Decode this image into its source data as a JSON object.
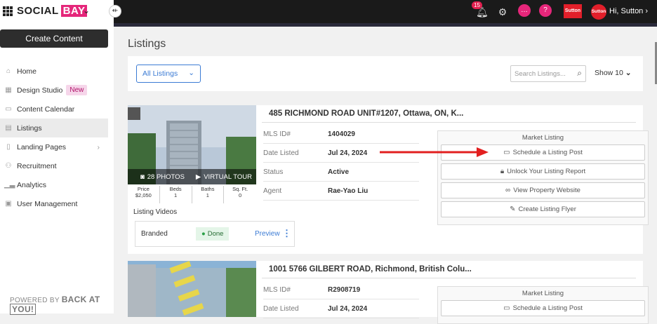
{
  "brand": {
    "name_part1": "SOCIAL",
    "name_part2": "BAY",
    "collapse_glyph": "⇷"
  },
  "sidebar": {
    "create_label": "Create Content",
    "items": [
      {
        "label": "Home",
        "icon": "home-icon"
      },
      {
        "label": "Design Studio",
        "icon": "design-icon",
        "badge": "New"
      },
      {
        "label": "Content Calendar",
        "icon": "calendar-icon"
      },
      {
        "label": "Listings",
        "icon": "listings-icon",
        "active": true
      },
      {
        "label": "Landing Pages",
        "icon": "page-icon",
        "chevron": true
      },
      {
        "label": "Recruitment",
        "icon": "people-icon"
      },
      {
        "label": "Analytics",
        "icon": "chart-icon"
      },
      {
        "label": "User Management",
        "icon": "users-icon"
      }
    ],
    "powered_by": "POWERED BY",
    "powered_brand": "BACK AT",
    "powered_you": "YOU!"
  },
  "topbar": {
    "notif_count": "15",
    "user_greeting": "Hi, Sutton",
    "sutton_logo": "Sutton",
    "sutton_avatar": "Sutton"
  },
  "page": {
    "title": "Listings"
  },
  "filters": {
    "select_value": "All Listings",
    "search_placeholder": "Search Listings...",
    "show_label": "Show 10"
  },
  "listings": [
    {
      "address": "485 RICHMOND ROAD UNIT#1207, Ottawa, ON, K...",
      "photos_label": "28 PHOTOS",
      "tour_label": "VIRTUAL TOUR",
      "stats": [
        {
          "k": "Price",
          "v": "$2,050"
        },
        {
          "k": "Beds",
          "v": "1"
        },
        {
          "k": "Baths",
          "v": "1"
        },
        {
          "k": "Sq. Ft.",
          "v": "0"
        }
      ],
      "rows": [
        {
          "k": "MLS ID#",
          "v": "1404029"
        },
        {
          "k": "Date Listed",
          "v": "Jul 24, 2024"
        },
        {
          "k": "Status",
          "v": "Active"
        },
        {
          "k": "Agent",
          "v": "Rae-Yao Liu"
        }
      ],
      "market_title": "Market Listing",
      "actions": [
        "Schedule a Listing Post",
        "Unlock Your Listing Report",
        "View Property Website",
        "Create Listing Flyer"
      ],
      "videos_title": "Listing Videos",
      "video": {
        "label": "Branded",
        "status": "Done",
        "preview": "Preview"
      }
    },
    {
      "address": "1001 5766 GILBERT ROAD, Richmond, British Colu...",
      "rows": [
        {
          "k": "MLS ID#",
          "v": "R2908719"
        },
        {
          "k": "Date Listed",
          "v": "Jul 24, 2024"
        }
      ],
      "market_title": "Market Listing",
      "actions": [
        "Schedule a Listing Post"
      ]
    }
  ],
  "colors": {
    "accent": "#3b7bd4",
    "brand_pink": "#e5267a",
    "arrow_red": "#e21f1f"
  }
}
